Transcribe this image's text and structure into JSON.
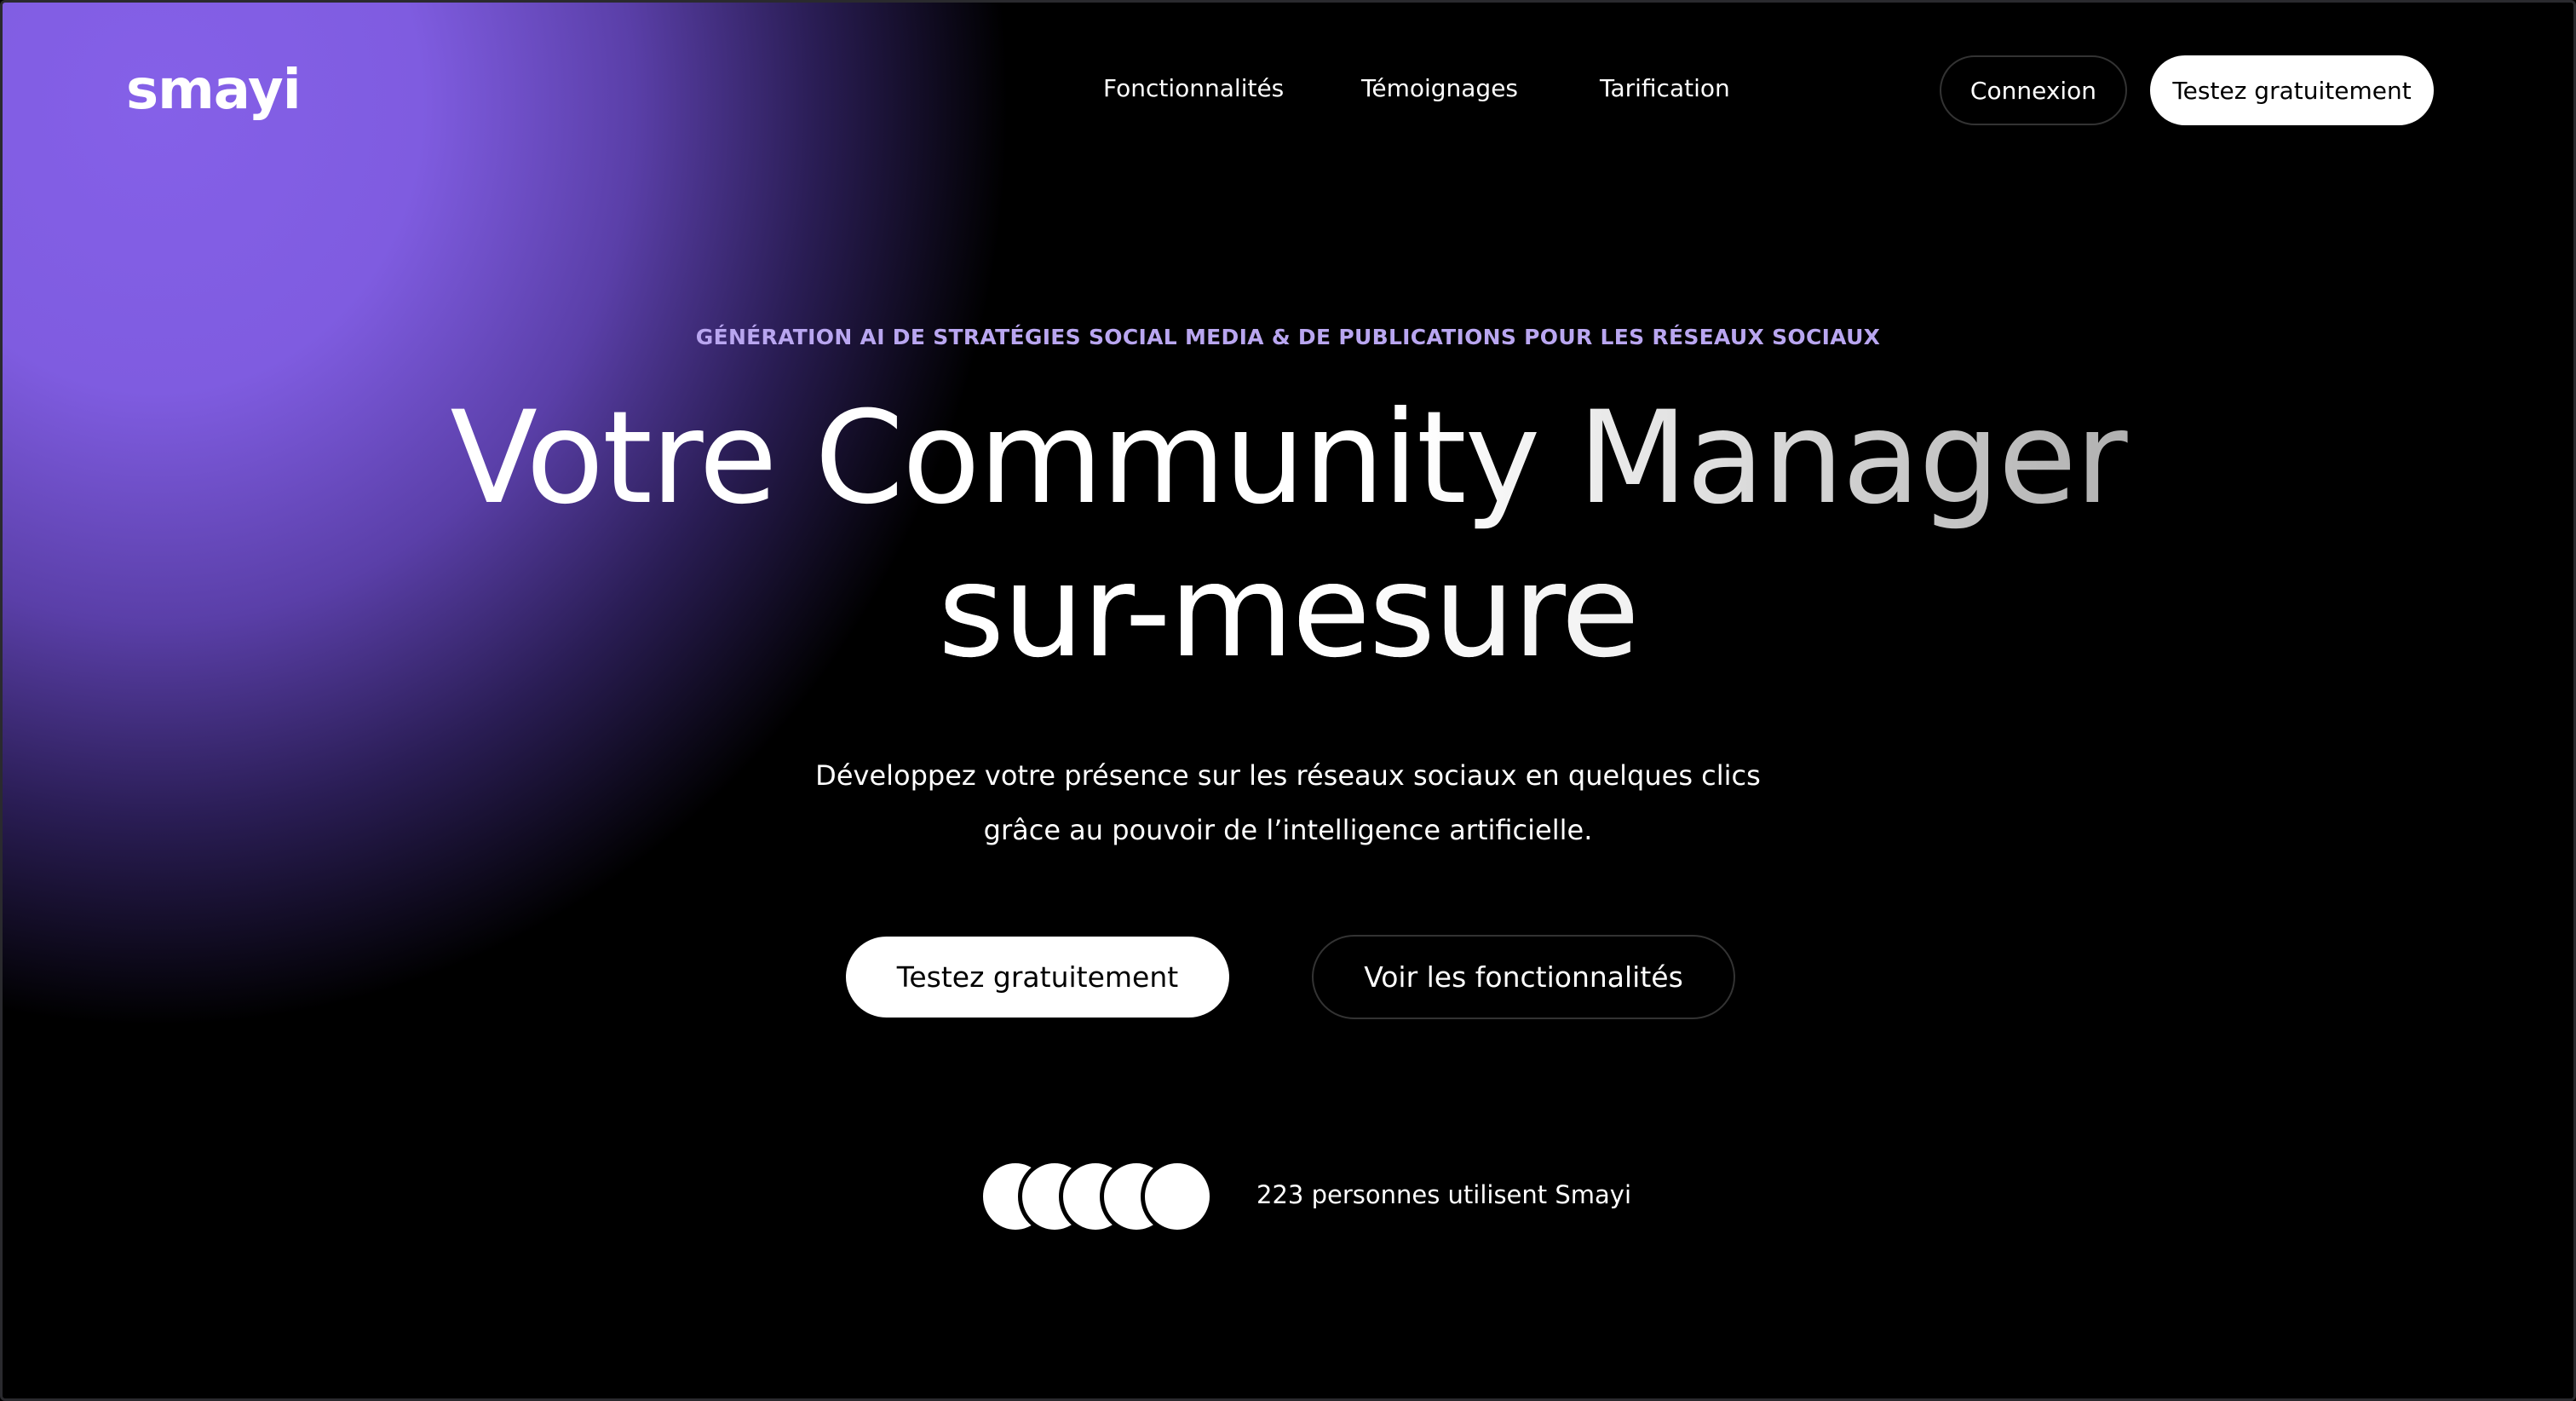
{
  "brand": {
    "logo": "smayi",
    "accent": "#8560e8"
  },
  "nav": {
    "items": [
      "Fonctionnalités",
      "Témoignages",
      "Tarification"
    ],
    "login": "Connexion",
    "cta": "Testez gratuitement"
  },
  "hero": {
    "tagline": "GÉNÉRATION AI DE STRATÉGIES SOCIAL MEDIA & DE PUBLICATIONS POUR LES RÉSEAUX SOCIAUX",
    "title_line1": "Votre Community Manager",
    "title_line2": "sur-mesure",
    "subtitle_line1": "Développez votre présence sur les réseaux sociaux en quelques clics",
    "subtitle_line2": "grâce au pouvoir de l’intelligence artificielle.",
    "primary_cta": "Testez gratuitement",
    "secondary_cta": "Voir les fonctionnalités"
  },
  "social_proof": {
    "text": "223 personnes utilisent Smayi",
    "avatar_count": 5
  }
}
